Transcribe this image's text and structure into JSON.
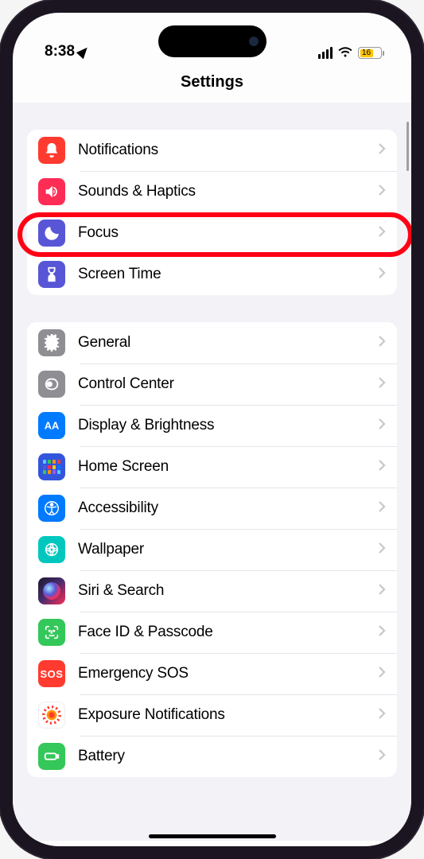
{
  "status": {
    "time": "8:38",
    "battery_percent": "16"
  },
  "header": {
    "title": "Settings"
  },
  "sections": [
    {
      "items": [
        {
          "label": "Notifications"
        },
        {
          "label": "Sounds & Haptics"
        },
        {
          "label": "Focus"
        },
        {
          "label": "Screen Time"
        }
      ]
    },
    {
      "items": [
        {
          "label": "General"
        },
        {
          "label": "Control Center"
        },
        {
          "label": "Display & Brightness"
        },
        {
          "label": "Home Screen"
        },
        {
          "label": "Accessibility"
        },
        {
          "label": "Wallpaper"
        },
        {
          "label": "Siri & Search"
        },
        {
          "label": "Face ID & Passcode"
        },
        {
          "label": "Emergency SOS"
        },
        {
          "label": "Exposure Notifications"
        },
        {
          "label": "Battery"
        }
      ]
    }
  ],
  "highlighted_row": "Focus",
  "sos_label": "SOS"
}
